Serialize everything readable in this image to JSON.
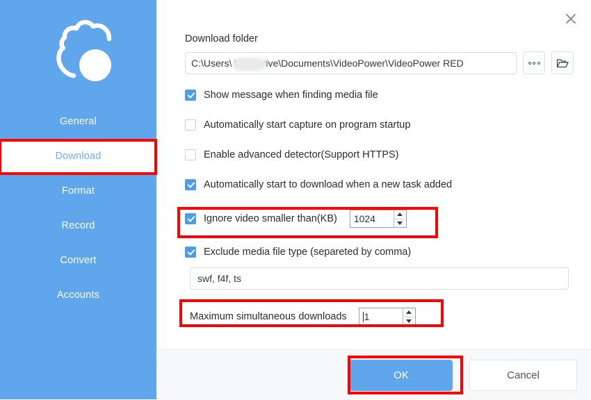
{
  "colors": {
    "sidebar_blue": "#60a6ec",
    "accent_blue": "#4a9eea",
    "highlight_red": "#ff0000",
    "footer_gray": "#f7f8f9"
  },
  "sidebar": {
    "logo_name": "videopower-cloud-logo",
    "items": [
      {
        "label": "General",
        "active": false
      },
      {
        "label": "Download",
        "active": true
      },
      {
        "label": "Format",
        "active": false
      },
      {
        "label": "Record",
        "active": false
      },
      {
        "label": "Convert",
        "active": false
      },
      {
        "label": "Accounts",
        "active": false
      }
    ]
  },
  "titlebar": {
    "close_glyph": "✕"
  },
  "download_folder": {
    "label": "Download folder",
    "path_value": "C:\\Users\\             \\OneDrive\\Documents\\VideoPower\\VideoPower RED",
    "browse_more_label": "○○○",
    "folder_icon_name": "open-folder-icon"
  },
  "options": [
    {
      "label": "Show message when finding media file",
      "checked": true
    },
    {
      "label": "Automatically start capture on program startup",
      "checked": false
    },
    {
      "label": "Enable advanced detector(Support HTTPS)",
      "checked": false
    },
    {
      "label": "Automatically start to download when a new task added",
      "checked": true
    }
  ],
  "ignore_video": {
    "label": "Ignore video smaller than(KB)",
    "checked": true,
    "value": "1024",
    "highlighted": true
  },
  "exclude_media": {
    "label": "Exclude media file type (separeted by comma)",
    "checked": true,
    "value": "swf, f4f, ts",
    "placeholder": "swf, f4f, ts"
  },
  "max_downloads": {
    "label": "Maximum simultaneous downloads",
    "value": "1",
    "highlighted": true
  },
  "footer": {
    "ok_label": "OK",
    "cancel_label": "Cancel",
    "ok_highlighted": true
  }
}
